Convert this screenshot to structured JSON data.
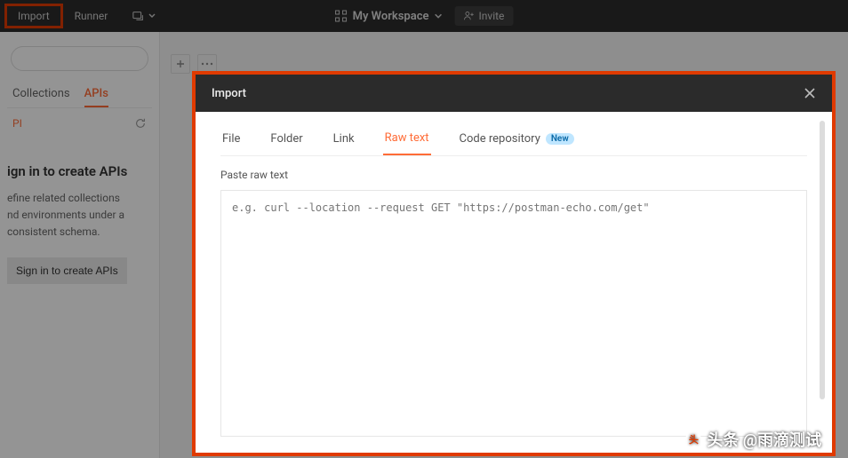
{
  "header": {
    "import_label": "Import",
    "runner_label": "Runner",
    "workspace_label": "My Workspace",
    "invite_label": "Invite"
  },
  "sidebar": {
    "tabs": {
      "collections": "Collections",
      "apis": "APIs"
    },
    "apis_label": "PI",
    "heading": "ign in to create APIs",
    "desc_line1": "efine related collections",
    "desc_line2": "nd environments under a",
    "desc_line3": "consistent schema.",
    "signin_btn": "Sign in to create APIs"
  },
  "modal": {
    "title": "Import",
    "tabs": {
      "file": "File",
      "folder": "Folder",
      "link": "Link",
      "raw": "Raw text",
      "repo": "Code repository",
      "new_badge": "New"
    },
    "paste_label": "Paste raw text",
    "placeholder": "e.g. curl --location --request GET \"https://postman-echo.com/get\""
  },
  "watermark": "头条 @雨滴测试"
}
